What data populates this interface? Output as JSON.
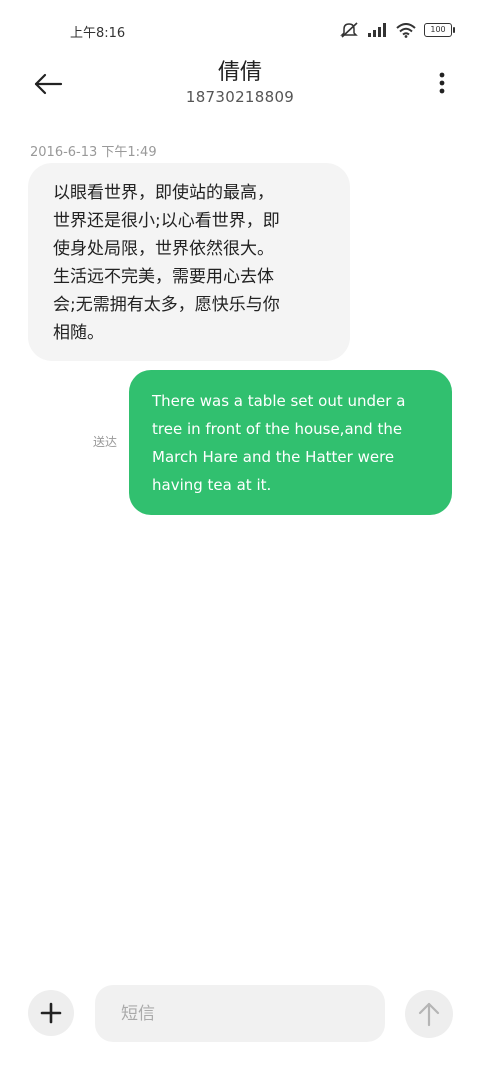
{
  "status_bar": {
    "time": "上午8:16",
    "battery": "100",
    "icons": [
      "mute-icon",
      "signal-icon",
      "wifi-icon",
      "battery-icon"
    ]
  },
  "header": {
    "contact_name": "倩倩",
    "contact_number": "18730218809",
    "back_icon": "arrow-left-icon",
    "more_icon": "more-vertical-icon"
  },
  "conversation": {
    "timestamp": "2016-6-13 下午1:49",
    "incoming": {
      "lines": [
        "以眼看世界，即使站的最高，",
        "世界还是很小;以心看世界，即",
        "使身处局限，世界依然很大。",
        "生活远不完美，需要用心去体",
        "会;无需拥有太多，愿快乐与你",
        "相随。"
      ]
    },
    "outgoing": {
      "lines": [
        "There was a table set out under a",
        "tree in front of the house,and the",
        "March Hare and the Hatter were",
        "having tea at it."
      ],
      "status": "送达"
    }
  },
  "composer": {
    "placeholder": "短信",
    "value": "",
    "add_icon": "plus-icon",
    "send_icon": "arrow-up-icon"
  },
  "colors": {
    "outgoing_bubble": "#31c06f",
    "incoming_bubble": "#f4f4f4",
    "background": "#ffffff"
  }
}
